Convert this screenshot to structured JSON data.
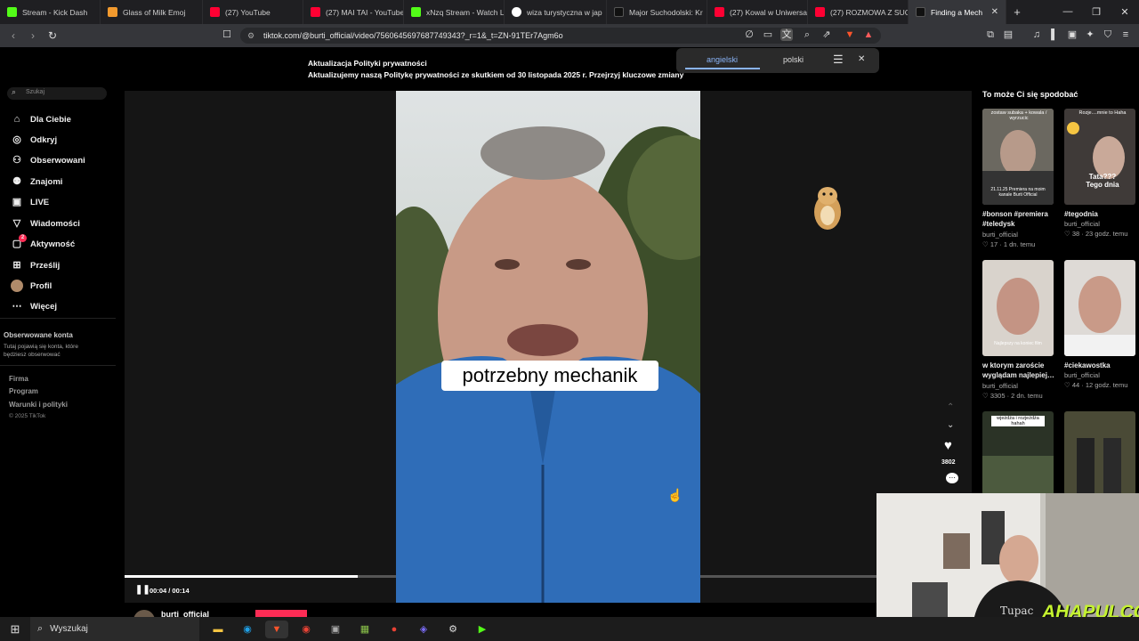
{
  "browser": {
    "tabs": [
      {
        "label": "Stream - Kick Dash",
        "color": "#53fc18"
      },
      {
        "label": "Glass of Milk Emoj",
        "color": "#f29a2e"
      },
      {
        "label": "(27) YouTube",
        "color": "#ff0033"
      },
      {
        "label": "(27) MAI TAI - YouTube",
        "color": "#ff0033"
      },
      {
        "label": "xNzq Stream - Watch L",
        "color": "#53fc18"
      },
      {
        "label": "wiza turystyczna w jap",
        "color": "#4285f4"
      },
      {
        "label": "Major Suchodolski: Kr",
        "color": "#111111"
      },
      {
        "label": "(27) Kowal w Uniwersa",
        "color": "#ff0033"
      },
      {
        "label": "(27) ROZMOWA Z SUC",
        "color": "#ff0033"
      },
      {
        "label": "Finding a Mech",
        "color": "#111111",
        "active": true
      }
    ],
    "url": "tiktok.com/@burti_official/video/7560645697687749343?_r=1&_t=ZN-91TEr7Agm6o"
  },
  "notice": {
    "title": "Aktualizacja Polityki prywatności",
    "body": "Aktualizujemy naszą Politykę prywatności ze skutkiem od 30 listopada 2025 r. Przejrzyj kluczowe zmiany"
  },
  "translate": {
    "lang1": "angielski",
    "lang2": "polski"
  },
  "sidebar": {
    "search_placeholder": "Szukaj",
    "items": [
      {
        "label": "Dla Ciebie",
        "icon": "home-icon"
      },
      {
        "label": "Odkryj",
        "icon": "compass-icon"
      },
      {
        "label": "Obserwowani",
        "icon": "user-follow-icon"
      },
      {
        "label": "Znajomi",
        "icon": "friends-icon"
      },
      {
        "label": "LIVE",
        "icon": "live-icon"
      },
      {
        "label": "Wiadomości",
        "icon": "send-icon"
      },
      {
        "label": "Aktywność",
        "icon": "activity-icon"
      },
      {
        "label": "Prześlij",
        "icon": "upload-icon"
      },
      {
        "label": "Profil",
        "icon": "avatar"
      },
      {
        "label": "Więcej",
        "icon": "more-icon"
      }
    ],
    "activity_badge": "2",
    "followed_title": "Obserwowane konta",
    "followed_body": "Tutaj pojawią się konta, które będziesz obserwować",
    "footer": [
      "Firma",
      "Program",
      "Warunki i polityki"
    ],
    "copyright": "© 2025 TikTok"
  },
  "video": {
    "caption": "potrzebny mechanik",
    "time": "00:04 / 00:14",
    "progress": 0.31,
    "author": "burti_official",
    "likes": "3802"
  },
  "recommendations": {
    "title": "To może Ci się spodobać",
    "items": [
      {
        "title": "#bonson #premiera #teledysk",
        "author": "burti_official",
        "likes": "17",
        "time": "1 dn. temu",
        "overlay": "zostaw subaka + kowala / wyrzucic",
        "overlay2": "21.11.25 Premiera na moim kanale Burti Official"
      },
      {
        "title": "#tegodnia",
        "author": "burti_official",
        "likes": "38",
        "time": "23 godz. temu",
        "overlay": "Rozje....mnie to Haha",
        "overlay2": "Tata??? Tego dnia"
      },
      {
        "title": "w ktorym zaroście wyglądam najlepiej…",
        "author": "burti_official",
        "likes": "3305",
        "time": "2 dn. temu",
        "overlay": "Najlepszy na koniec film"
      },
      {
        "title": "#ciekawostka",
        "author": "burti_official",
        "likes": "44",
        "time": "12 godz. temu",
        "overlay": ""
      },
      {
        "title": "",
        "author": "",
        "likes": "",
        "time": "",
        "overlay": "wjeżdża i rozjeżdża hahah"
      },
      {
        "title": "",
        "author": "",
        "likes": "",
        "time": "",
        "overlay": ""
      }
    ]
  },
  "taskbar": {
    "search": "Wyszukaj"
  },
  "webcam": {
    "shirt": "Tupac",
    "logo": "AHAPULCO"
  }
}
